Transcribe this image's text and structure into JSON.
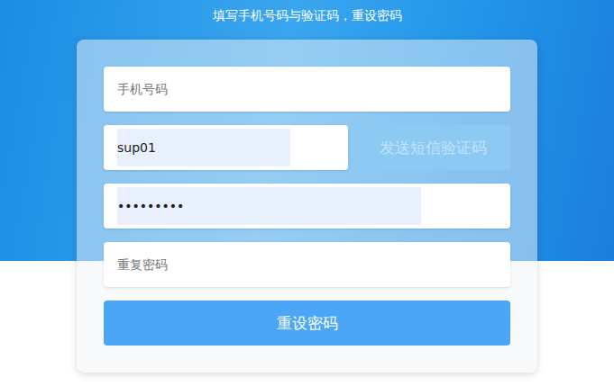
{
  "header": {
    "title": "填写手机号码与验证码，重设密码"
  },
  "fields": [
    {
      "kind": "text",
      "placeholder": "手机号码",
      "value": "",
      "autofilled": false
    },
    {
      "kind": "code",
      "value": "sup01",
      "autofilled": true,
      "action": {
        "label": "发送短信验证码",
        "disabled": true
      }
    },
    {
      "kind": "password",
      "value": "•••••••••",
      "autofilled": true
    },
    {
      "kind": "text",
      "placeholder": "重复密码",
      "value": "",
      "autofilled": false
    }
  ],
  "submit": {
    "label": "重设密码"
  }
}
